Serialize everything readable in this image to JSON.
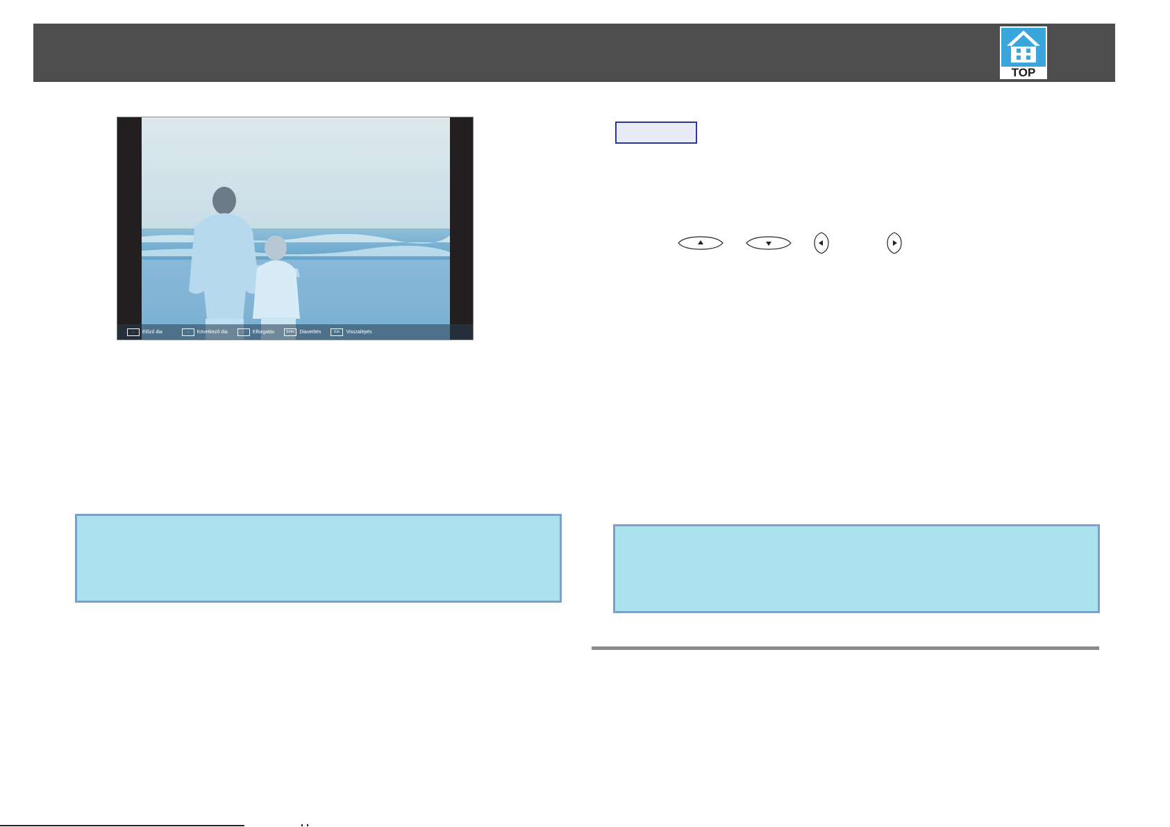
{
  "header": {
    "logo_label": "TOP"
  },
  "slideshow": {
    "hints": [
      {
        "key": "←",
        "label": "Előző dia"
      },
      {
        "key": "→",
        "label": "Következő dia"
      },
      {
        "key": "↕",
        "label": "Elforgatás"
      },
      {
        "key": "Enter",
        "label": "Diavetítés"
      },
      {
        "key": "Esc",
        "label": "Visszalépés"
      }
    ]
  },
  "colors": {
    "header": "#4d4d4d",
    "note_fill": "#ace2ee",
    "note_border": "#7ba1cb",
    "label_border": "#2a3796"
  }
}
